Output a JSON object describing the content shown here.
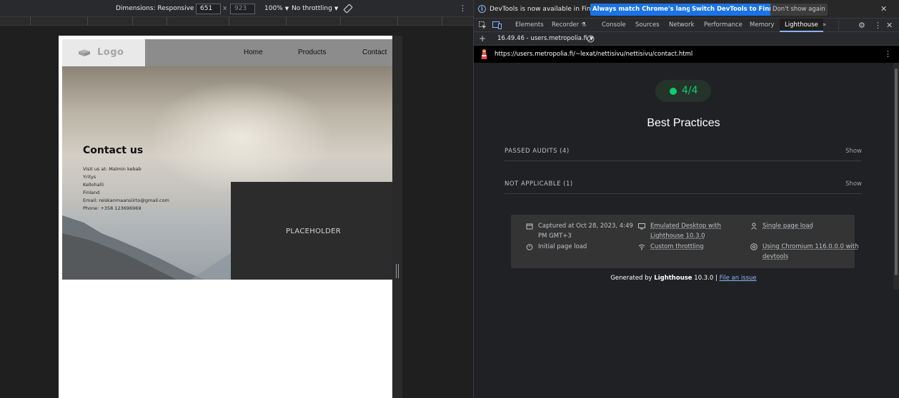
{
  "emulation_toolbar": {
    "dimensions_label": "Dimensions: Responsive",
    "width_value": "651",
    "times_symbol": "x",
    "height_value": "923",
    "zoom": "100%",
    "throttling": "No throttling"
  },
  "site": {
    "logo": "Logo",
    "nav": [
      "Home",
      "Products",
      "Contact"
    ],
    "contact_title": "Contact us",
    "contact_lines": [
      "Visit us at: Malmin kebab",
      "Yritys",
      "Kellohalli",
      "Finland",
      "Email: reiskanmaansiirto@gmail.com",
      "Phone: +358 123696969"
    ],
    "placeholder_text": "PLACEHOLDER"
  },
  "devtools": {
    "infobar": {
      "message": "DevTools is now available in Finnish!",
      "btn_match": "Always match Chrome's language",
      "btn_switch": "Switch DevTools to Finnish",
      "btn_dismiss": "Don't show again"
    },
    "tabs": [
      "Elements",
      "Recorder",
      "Console",
      "Sources",
      "Network",
      "Performance",
      "Memory",
      "Lighthouse"
    ],
    "active_tab": "Lighthouse",
    "report_selector": "16.49.46 - users.metropolia.fi",
    "url": "https://users.metropolia.fi/~lexat/nettisivu/nettisivu/contact.html",
    "report": {
      "score": "4/4",
      "category": "Best Practices",
      "groups": [
        {
          "label": "PASSED AUDITS (4)",
          "action": "Show"
        },
        {
          "label": "NOT APPLICABLE (1)",
          "action": "Show"
        }
      ],
      "env": {
        "captured_line1": "Captured at Oct 28, 2023, 4:49",
        "captured_line2": "PM GMT+3",
        "initial_load": "Initial page load",
        "emulated_line1": "Emulated Desktop with",
        "emulated_line2": "Lighthouse 10.3.0",
        "throttling": "Custom throttling",
        "single_load": "Single page load",
        "chromium_line1": "Using Chromium 116.0.0.0 with",
        "chromium_line2": "devtools"
      },
      "generated_prefix": "Generated by",
      "generated_brand": "Lighthouse",
      "generated_version": "10.3.0 |",
      "file_issue": "File an issue"
    }
  },
  "colors": {
    "accent_blue": "#1a73e8",
    "score_green": "#0cce6b",
    "devtools_bg": "#202124"
  }
}
